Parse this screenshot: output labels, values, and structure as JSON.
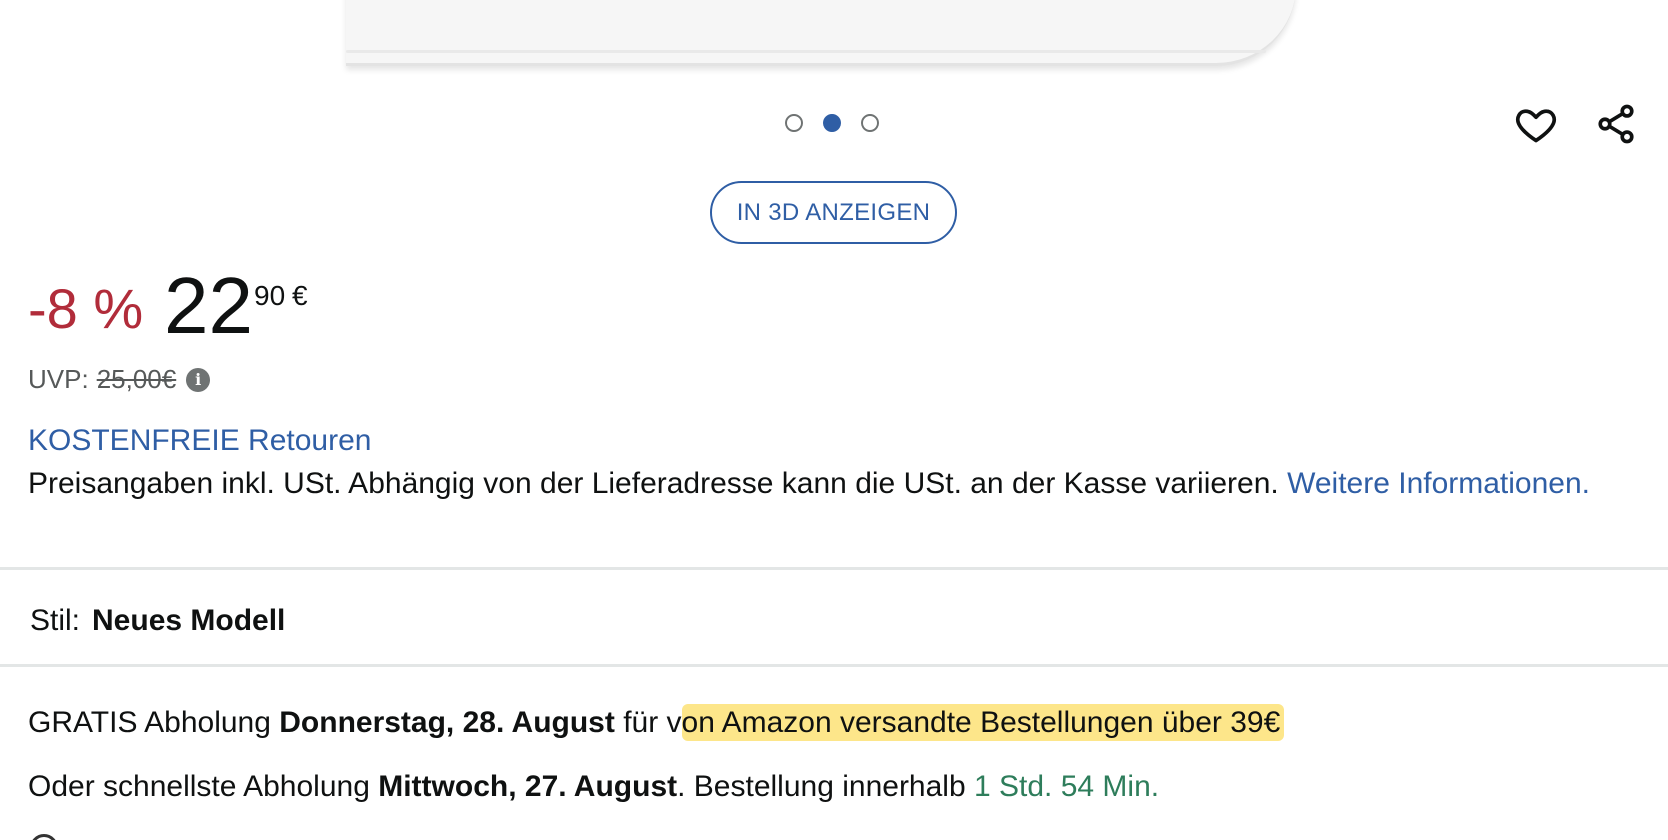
{
  "carousel": {
    "count": 3,
    "active_index": 1
  },
  "actions": {
    "favorite_icon": "heart-icon",
    "share_icon": "share-icon"
  },
  "view_3d": {
    "label": "IN 3D ANZEIGEN"
  },
  "price": {
    "discount": "-8 %",
    "whole": "22",
    "fraction": "90",
    "currency": "€",
    "uvp_label": "UVP:",
    "uvp_value": "25,00€",
    "info_icon": "i"
  },
  "returns": {
    "label": "KOSTENFREIE Retouren"
  },
  "tax_note": {
    "text": "Preisangaben inkl. USt. Abhängig von der Lieferadresse kann die USt. an der Kasse variieren. ",
    "link": "Weitere Informationen."
  },
  "style": {
    "label": "Stil:",
    "value": "Neues Modell"
  },
  "delivery": {
    "line1_prefix": "GRATIS Abholung ",
    "line1_date": "Donnerstag, 28. August",
    "line1_mid": " für v",
    "line1_highlight": "on Amazon versandte Bestellungen über 39€",
    "line2_prefix": "Oder schnellste Abholung ",
    "line2_date": "Mittwoch, 27. August",
    "line2_mid": ". Bestellung innerhalb ",
    "line2_countdown": "1 Std. 54 Min."
  },
  "colors": {
    "link": "#2f5ea5",
    "discount": "#b12c3a",
    "countdown": "#2e7d5b",
    "highlight": "#fde68a"
  }
}
